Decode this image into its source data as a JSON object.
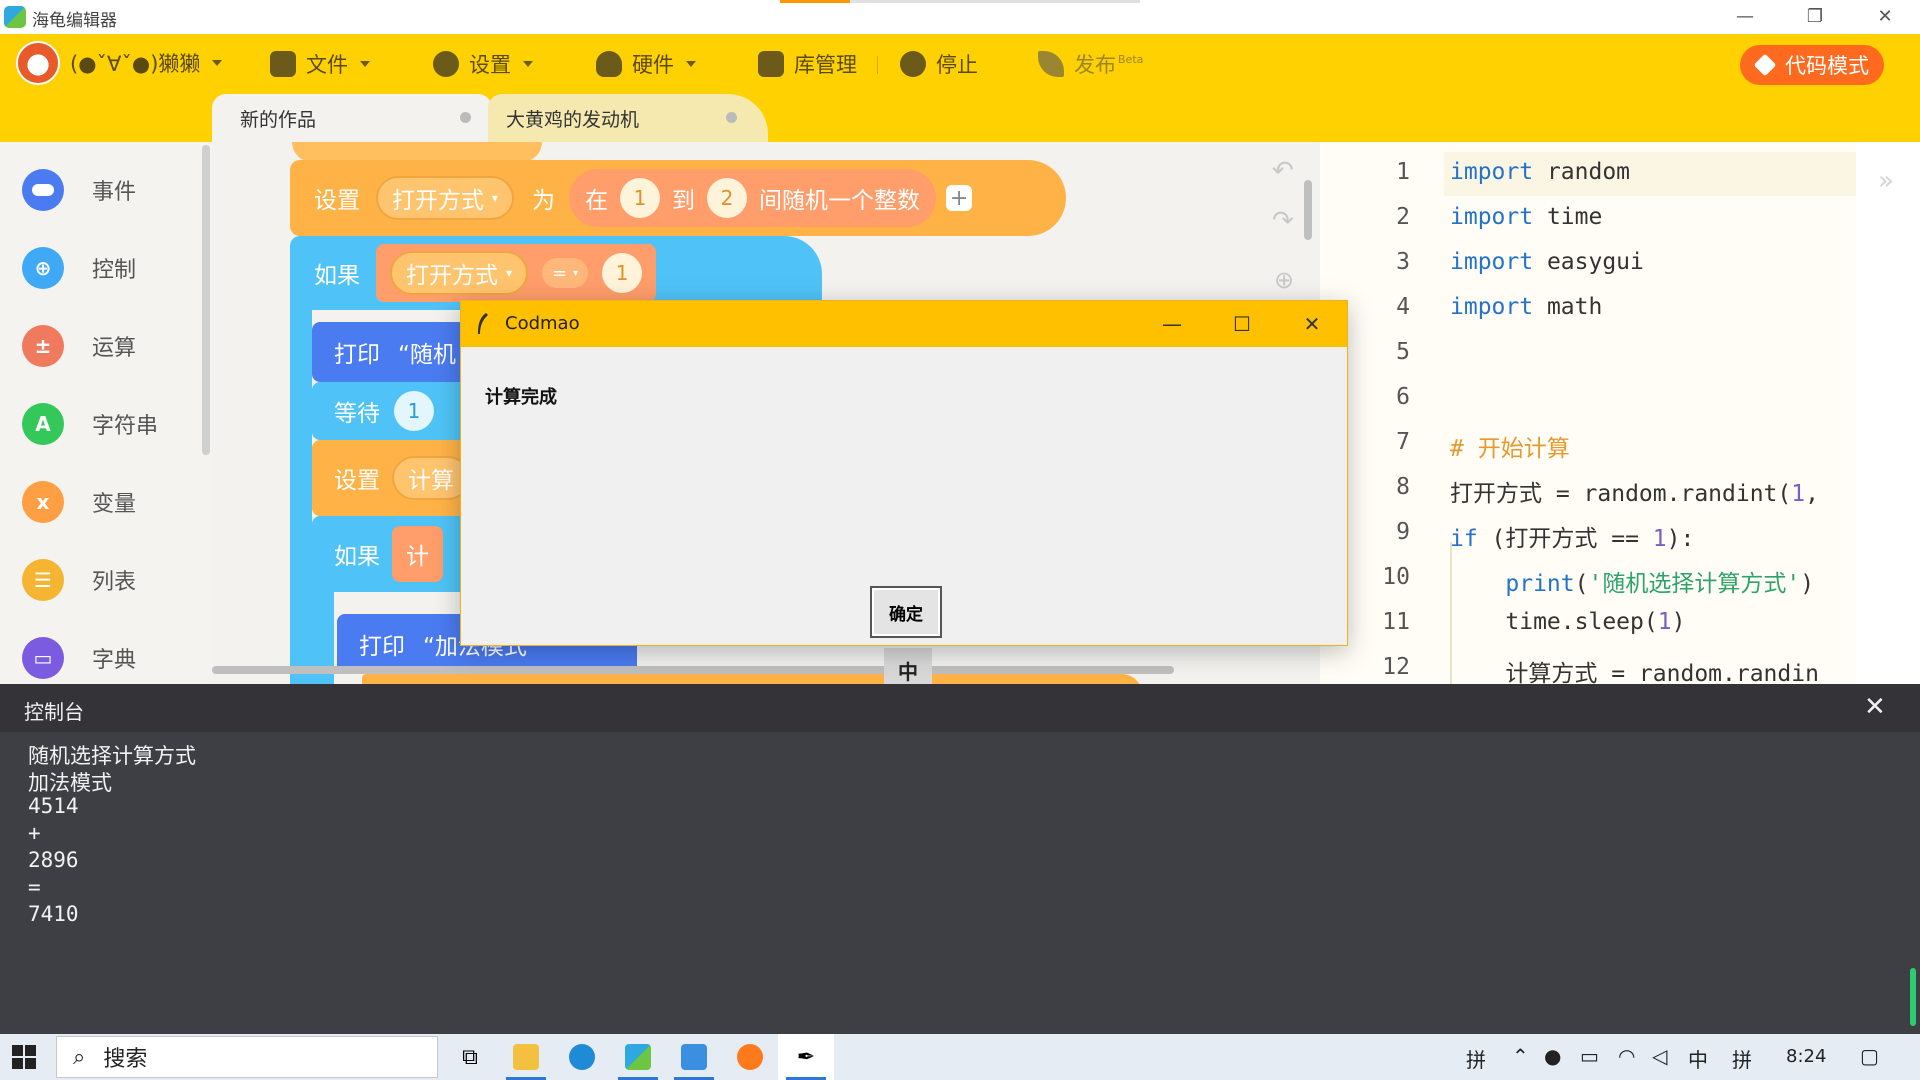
{
  "window": {
    "title": "海龟编辑器"
  },
  "toolbar": {
    "user": "(●ˇ∀ˇ●)獭獭",
    "file": "文件",
    "settings": "设置",
    "hardware": "硬件",
    "library": "库管理",
    "stop": "停止",
    "publish": "发布",
    "publish_badge": "Beta",
    "code_mode": "代码模式"
  },
  "tabs": [
    {
      "label": "新的作品"
    },
    {
      "label": "大黄鸡的发动机"
    }
  ],
  "categories": [
    {
      "label": "事件",
      "color": "#4a7bf0"
    },
    {
      "label": "控制",
      "color": "#3fa9f5"
    },
    {
      "label": "运算",
      "color": "#f07a5e"
    },
    {
      "label": "字符串",
      "color": "#34c759"
    },
    {
      "label": "变量",
      "color": "#ff9f43"
    },
    {
      "label": "列表",
      "color": "#f5b431"
    },
    {
      "label": "字典",
      "color": "#7b5ce0"
    }
  ],
  "blocks": {
    "set1": {
      "label": "设置",
      "var": "打开方式",
      "as": "为",
      "in": "在",
      "from": "1",
      "to": "到",
      "to_val": "2",
      "rand": "间随机一个整数",
      "plus": "+"
    },
    "if1": {
      "label": "如果",
      "var": "打开方式",
      "op": "=",
      "val": "1"
    },
    "print1": {
      "label": "打印",
      "text": "“随机"
    },
    "wait1": {
      "label": "等待",
      "val": "1"
    },
    "set2": {
      "label": "设置",
      "var": "计算"
    },
    "if2": {
      "label": "如果",
      "var": "计"
    },
    "print2": {
      "label": "打印",
      "text": "“加法模式"
    },
    "zoom_center": "中"
  },
  "dialog": {
    "title": "Codmao",
    "message": "计算完成",
    "ok": "确定"
  },
  "editor": {
    "line_numbers": [
      "1",
      "2",
      "3",
      "4",
      "5",
      "6",
      "7",
      "8",
      "9",
      "10",
      "11",
      "12"
    ],
    "lines": [
      {
        "kw": "import",
        "rest": " random"
      },
      {
        "kw": "import",
        "rest": " time"
      },
      {
        "kw": "import",
        "rest": " easygui"
      },
      {
        "kw": "import",
        "rest": " math"
      },
      {
        "kw": "",
        "rest": ""
      },
      {
        "kw": "",
        "rest": ""
      },
      {
        "comment": "# 开始计算"
      },
      {
        "pre": "打开方式 = random.randint(",
        "num": "1",
        "post": ","
      },
      {
        "kw": "if",
        "pre": " (打开方式 == ",
        "num": "1",
        "post": "):"
      },
      {
        "indent": "    ",
        "kw": "print",
        "pre": "(",
        "str": "'随机选择计算方式'",
        "post": ")"
      },
      {
        "indent": "    ",
        "pre": "time.sleep(",
        "num": "1",
        "post": ")"
      },
      {
        "indent": "    ",
        "pre": "计算方式 = random.randin"
      }
    ]
  },
  "console": {
    "title": "控制台",
    "lines": [
      "随机选择计算方式",
      "加法模式",
      "4514",
      "+",
      "2896",
      "=",
      "7410"
    ]
  },
  "taskbar": {
    "search_placeholder": "搜索",
    "ime1": "拼",
    "lang": "中",
    "ime2": "拼",
    "time": "8:24"
  }
}
